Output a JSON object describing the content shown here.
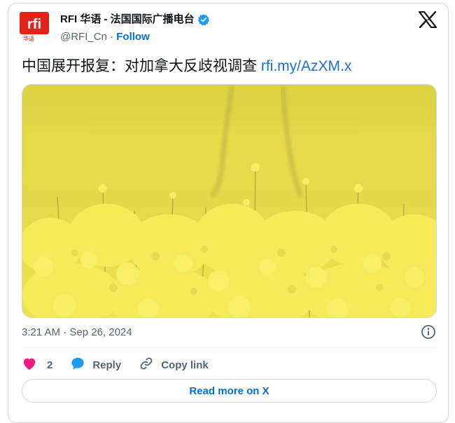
{
  "author": {
    "name": "RFI 华语 - 法国国际广播电台",
    "handle": "@RFI_Cn",
    "separator": "·",
    "follow_label": "Follow",
    "avatar_logo_text": "rfi",
    "avatar_sub_text": "华语"
  },
  "tweet": {
    "text": "中国展开报复：对加拿大反歧视调查",
    "link": "rfi.my/AzXM.x"
  },
  "media": {
    "description": "yellow rapeseed flower field"
  },
  "meta": {
    "timestamp": "3:21 AM · Sep 26, 2024"
  },
  "actions": {
    "like_count": "2",
    "reply_label": "Reply",
    "copy_link_label": "Copy link"
  },
  "footer": {
    "read_more_label": "Read more on X"
  },
  "colors": {
    "accent": "#006fd6",
    "verified": "#1d9bf0",
    "like": "#f91880",
    "reply": "#1d9bf0",
    "brand_red": "#e2231a",
    "flowers": "#f3e64a"
  },
  "icons": [
    "verified-badge-icon",
    "x-logo-icon",
    "info-icon",
    "heart-icon",
    "reply-bubble-icon",
    "link-icon"
  ]
}
